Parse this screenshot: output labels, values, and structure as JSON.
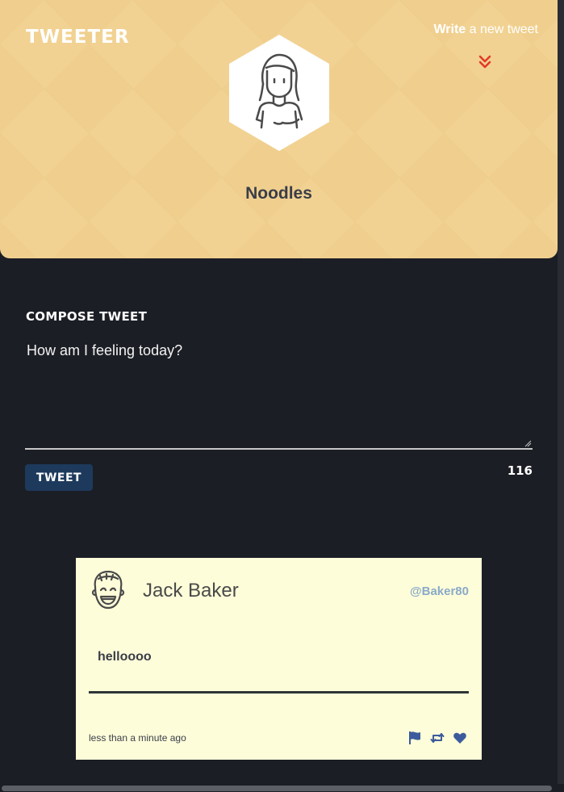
{
  "header": {
    "logo": "Tweeter",
    "write_link": {
      "strong": "Write",
      "rest": " a new tweet"
    },
    "user_name": "Noodles",
    "background_color": "#f0cf8e",
    "chevron_color": "#e23a2a"
  },
  "compose": {
    "label": "Compose Tweet",
    "placeholder": "How am I feeling today?",
    "button_label": "Tweet",
    "char_counter": "116"
  },
  "tweets": [
    {
      "name": "Jack Baker",
      "handle": "@Baker80",
      "text": "helloooo",
      "time": "less than a minute ago",
      "icons": [
        "flag-icon",
        "retweet-icon",
        "heart-icon"
      ]
    }
  ]
}
